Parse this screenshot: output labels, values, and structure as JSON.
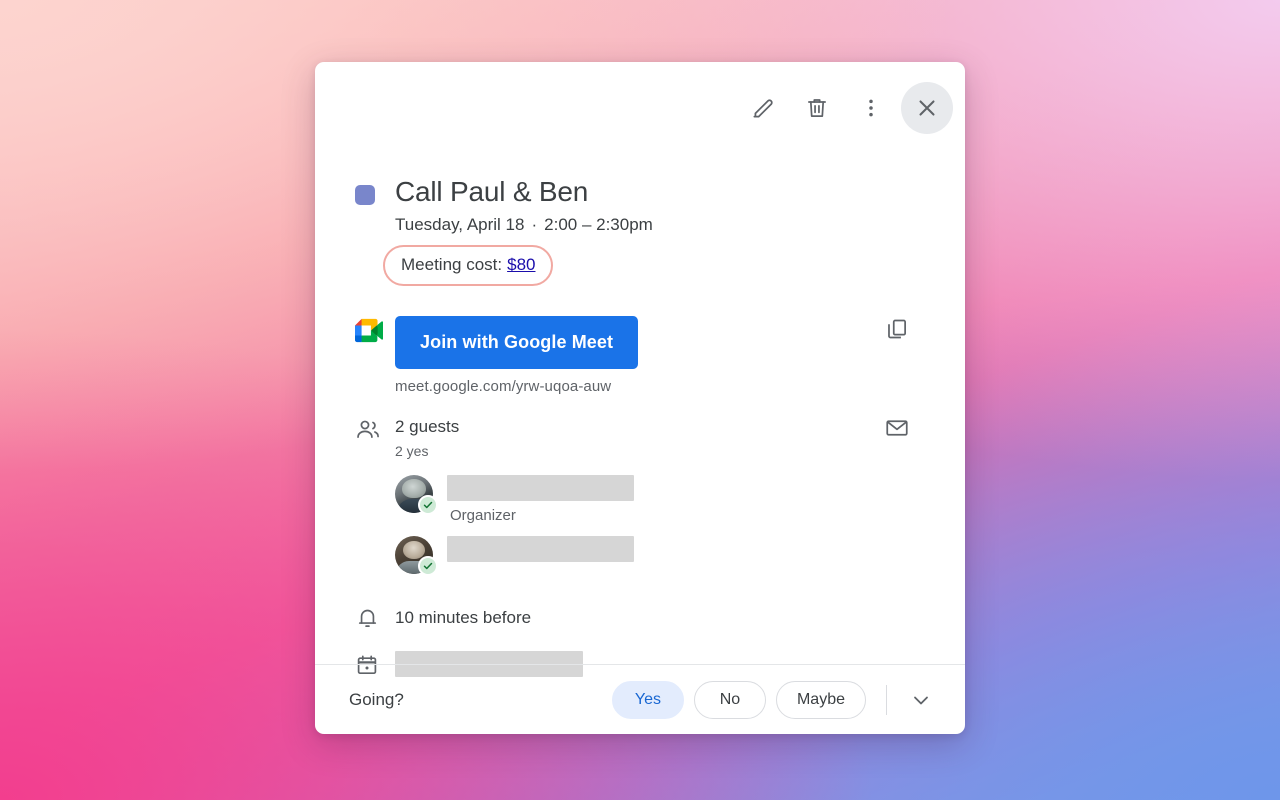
{
  "dialog": {
    "actions": {
      "edit": "Edit",
      "delete": "Delete",
      "options": "Options",
      "close": "Close"
    },
    "event": {
      "color_hex": "#7986cb",
      "title": "Call Paul & Ben",
      "date": "Tuesday, April 18",
      "separator": "·",
      "time": "2:00 – 2:30pm",
      "cost_label": "Meeting cost:",
      "cost_value": "$80",
      "cost_border_hex": "#f1a9a2",
      "cost_link_hex": "#1a0dab"
    },
    "conference": {
      "provider_icon": "google-meet-icon",
      "join_label": "Join with Google Meet",
      "join_bg_hex": "#1a73e8",
      "url": "meet.google.com/yrw-uqoa-auw",
      "copy_icon": "copy-icon"
    },
    "guests": {
      "icon": "people-icon",
      "count_label": "2 guests",
      "status_label": "2 yes",
      "email_icon": "email-icon",
      "list": [
        {
          "name_redacted": true,
          "role": "Organizer",
          "rsvp": "yes",
          "avatar": "avatar-photo-1"
        },
        {
          "name_redacted": true,
          "role": "",
          "rsvp": "yes",
          "avatar": "avatar-photo-2"
        }
      ]
    },
    "reminder": {
      "icon": "bell-icon",
      "text": "10 minutes before"
    },
    "calendar": {
      "icon": "calendar-icon",
      "name_redacted": true
    },
    "footer": {
      "prompt": "Going?",
      "rsvp_options": [
        {
          "label": "Yes",
          "selected": true
        },
        {
          "label": "No",
          "selected": false
        },
        {
          "label": "Maybe",
          "selected": false
        }
      ],
      "more_icon": "chevron-down-icon",
      "selected_bg_hex": "#e3ecfd",
      "selected_text_hex": "#1967d2"
    }
  }
}
